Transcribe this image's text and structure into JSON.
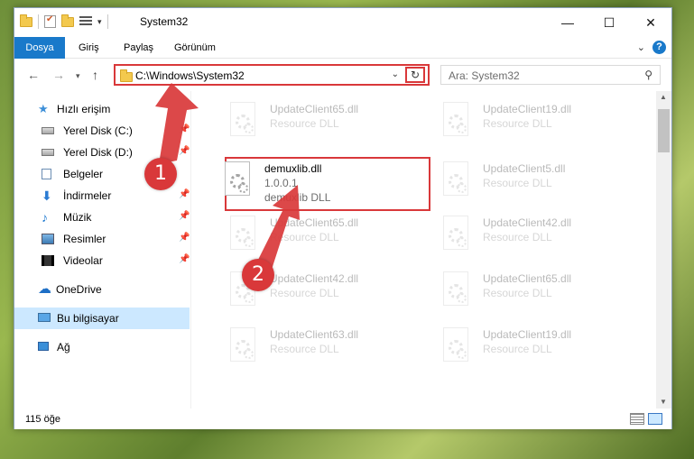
{
  "window": {
    "title": "System32"
  },
  "ribbon": {
    "tabs": [
      "Dosya",
      "Giriş",
      "Paylaş",
      "Görünüm"
    ]
  },
  "address": {
    "path": "C:\\Windows\\System32",
    "search_placeholder": "Ara: System32"
  },
  "nav": {
    "quick_access": "Hızlı erişim",
    "items": [
      {
        "label": "Yerel Disk (C:)",
        "icon": "drive-icon"
      },
      {
        "label": "Yerel Disk (D:)",
        "icon": "drive-icon"
      },
      {
        "label": "Belgeler",
        "icon": "documents-icon"
      },
      {
        "label": "İndirmeler",
        "icon": "downloads-icon"
      },
      {
        "label": "Müzik",
        "icon": "music-icon"
      },
      {
        "label": "Resimler",
        "icon": "pictures-icon"
      },
      {
        "label": "Videolar",
        "icon": "videos-icon"
      }
    ],
    "onedrive": "OneDrive",
    "this_pc": "Bu bilgisayar",
    "network": "Ağ"
  },
  "files": [
    {
      "name": "UpdateClient65.dll",
      "type": "Resource DLL"
    },
    {
      "name": "UpdateClient19.dll",
      "type": "Resource DLL"
    },
    {
      "name": "demuxlib.dll",
      "version": "1.0.0.1",
      "type": "demuxlib DLL"
    },
    {
      "name": "UpdateClient5.dll",
      "type": "Resource DLL"
    },
    {
      "name": "UpdateClient65.dll",
      "type": "Resource DLL"
    },
    {
      "name": "UpdateClient42.dll",
      "type": "Resource DLL"
    },
    {
      "name": "UpdateClient42.dll",
      "type": "Resource DLL"
    },
    {
      "name": "UpdateClient65.dll",
      "type": "Resource DLL"
    },
    {
      "name": "UpdateClient63.dll",
      "type": "Resource DLL"
    },
    {
      "name": "UpdateClient19.dll",
      "type": "Resource DLL"
    }
  ],
  "status": {
    "count": "115 öğe"
  },
  "callouts": [
    "1",
    "2"
  ],
  "colors": {
    "accent": "#1979ca",
    "highlight": "#d9383a",
    "selection": "#cce8ff"
  }
}
